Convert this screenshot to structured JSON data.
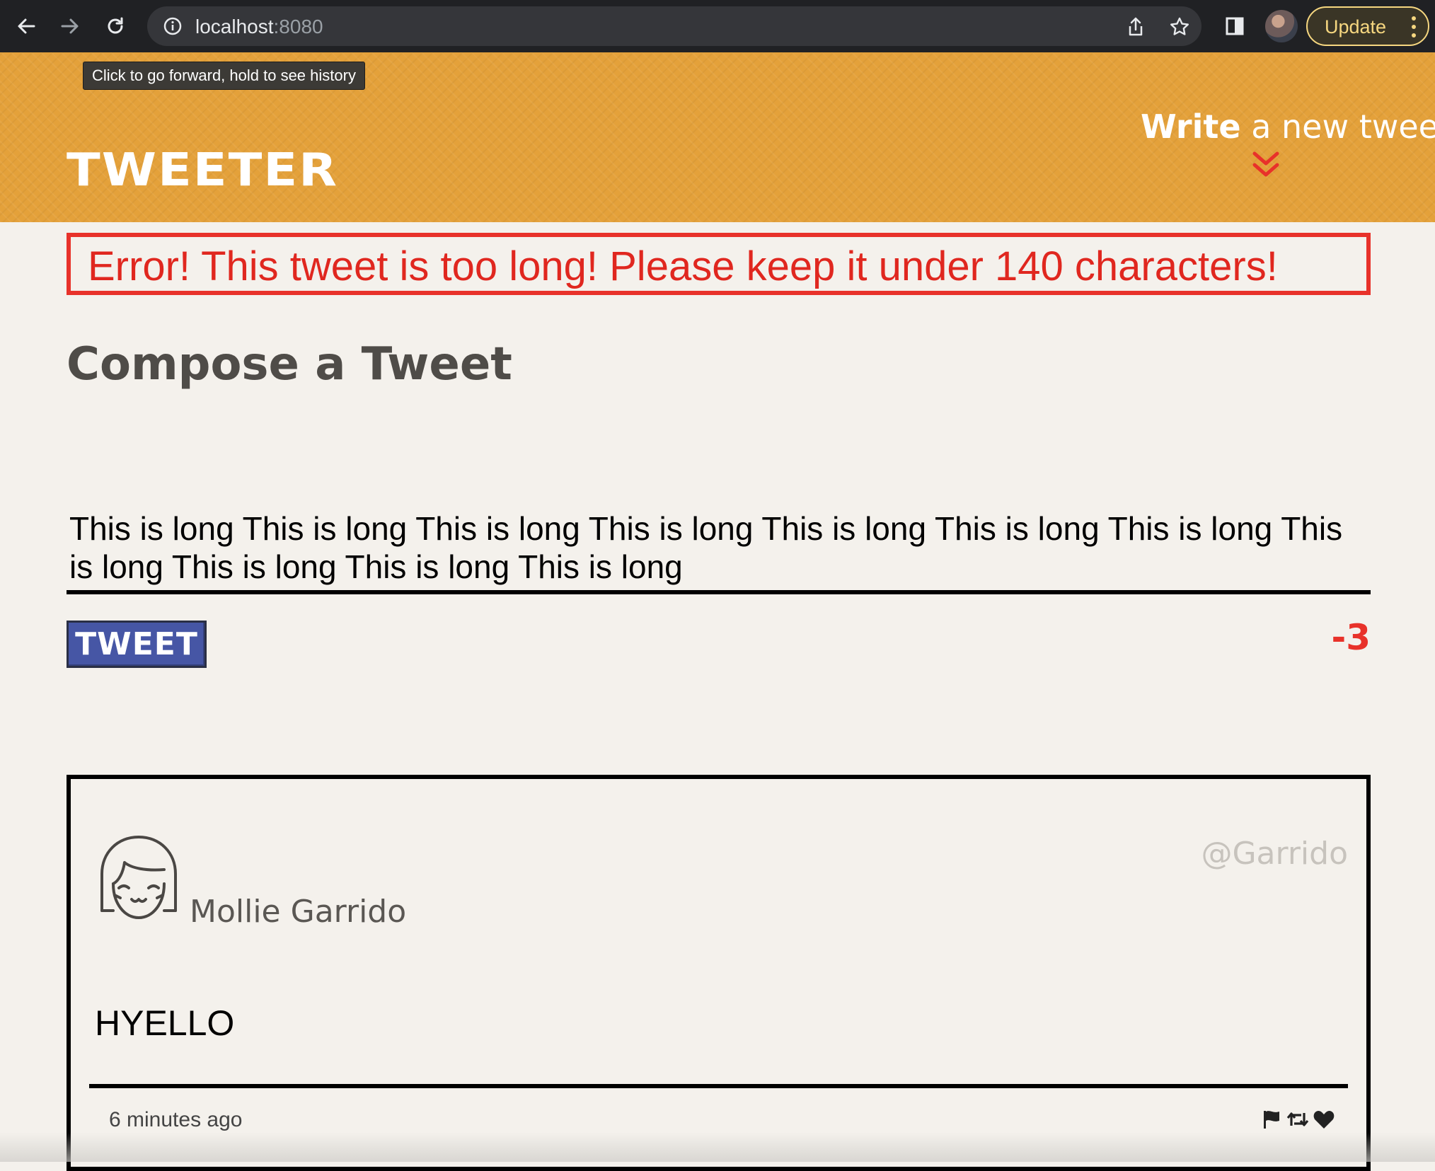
{
  "browser": {
    "url_host": "localhost",
    "url_port": ":8080",
    "update_label": "Update",
    "tooltip": "Click to go forward, hold to see history"
  },
  "header": {
    "brand": "TWEETER",
    "write_bold": "Write",
    "write_rest": " a new tweet",
    "accent_color": "#e4a13a"
  },
  "compose": {
    "error": "Error! This tweet is too long! Please keep it under 140 characters!",
    "title": "Compose a Tweet",
    "input_value": "This is long This is long This is long This is long This is long This is long This is long This is long This is long This is long This is long",
    "button_label": "TWEET",
    "counter": "-3",
    "error_color": "#e8322a",
    "button_color": "#4656a5"
  },
  "tweets": [
    {
      "name": "Mollie Garrido",
      "handle": "@Garrido",
      "content": "HYELLO",
      "time": "6 minutes ago",
      "icons": [
        "flag-icon",
        "retweet-icon",
        "heart-icon"
      ]
    }
  ]
}
